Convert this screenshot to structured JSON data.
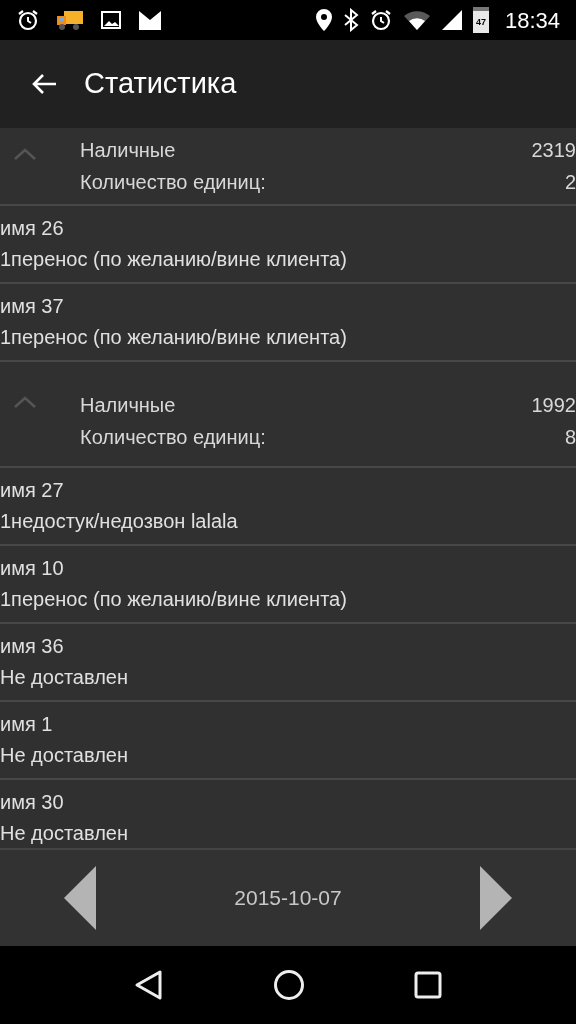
{
  "status_bar": {
    "time": "18:34",
    "battery": "47"
  },
  "toolbar": {
    "title": "Статистика"
  },
  "groups": [
    {
      "expanded": true,
      "label": "Наличные",
      "amount": "2319",
      "count_label": "Количество единиц:",
      "count": "2",
      "items": [
        {
          "name": "имя 26",
          "status": "1перенос (по желанию/вине клиента)"
        },
        {
          "name": "имя 37",
          "status": "1перенос (по желанию/вине клиента)"
        }
      ]
    },
    {
      "expanded": true,
      "label": "Наличные",
      "amount": "1992",
      "count_label": "Количество единиц:",
      "count": "8",
      "items": [
        {
          "name": "имя 27",
          "status": "1недостук/недозвон lalala"
        },
        {
          "name": "имя 10",
          "status": "1перенос (по желанию/вине клиента)"
        },
        {
          "name": "имя 36",
          "status": "Не доставлен"
        },
        {
          "name": "имя 1",
          "status": "Не доставлен"
        },
        {
          "name": "имя 30",
          "status": "Не доставлен"
        }
      ]
    }
  ],
  "footer": {
    "date": "2015-10-07"
  }
}
